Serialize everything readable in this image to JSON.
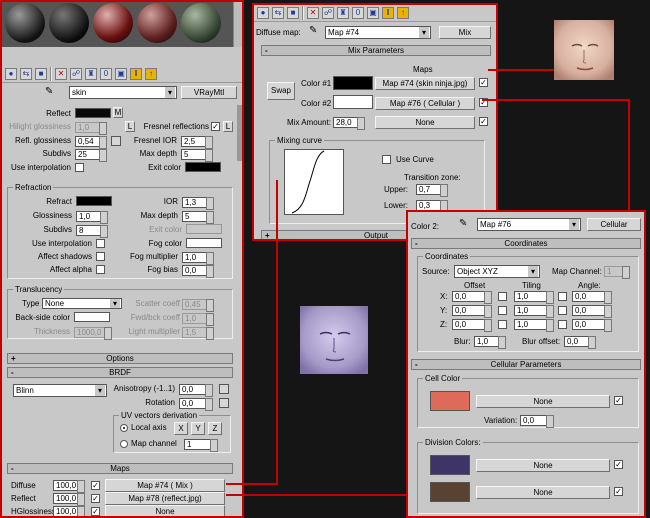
{
  "material_editor": {
    "material_name": "skin",
    "material_type": "VRayMtl",
    "reflection": {
      "reflect_label": "Reflect",
      "reflect_map_btn": "M",
      "hilight_label": "Hilight glossiness",
      "hilight_value": "1,0",
      "hilight_btn": "L",
      "fresnel_label": "Fresnel reflections",
      "fresnel_btn": "L",
      "refl_gloss_label": "Refl. glossiness",
      "refl_gloss_value": "0,54",
      "fresnel_ior_label": "Fresnel IOR",
      "fresnel_ior_value": "2,5",
      "subdivs_label": "Subdivs",
      "subdivs_value": "25",
      "max_depth_label": "Max depth",
      "max_depth_value": "5",
      "use_interp_label": "Use interpolation",
      "exit_color_label": "Exit color"
    },
    "refraction": {
      "title": "Refraction",
      "refract_label": "Refract",
      "ior_label": "IOR",
      "ior_value": "1,3",
      "gloss_label": "Glossiness",
      "gloss_value": "1,0",
      "max_depth_label": "Max depth",
      "max_depth_value": "5",
      "subdivs_label": "Subdivs",
      "subdivs_value": "8",
      "exit_color_label": "Exit color",
      "use_interp_label": "Use interpolation",
      "fog_color_label": "Fog color",
      "affect_shadows_label": "Affect shadows",
      "fog_mult_label": "Fog multiplier",
      "fog_mult_value": "1,0",
      "affect_alpha_label": "Affect alpha",
      "fog_bias_label": "Fog bias",
      "fog_bias_value": "0,0"
    },
    "translucency": {
      "title": "Translucency",
      "type_label": "Type",
      "type_value": "None",
      "scatter_label": "Scatter coeff",
      "scatter_value": "0,45",
      "backside_label": "Back-side color",
      "fwdbck_label": "Fwd/bck coeff",
      "fwdbck_value": "1,0",
      "thickness_label": "Thickness",
      "thickness_value": "1000,0",
      "light_mult_label": "Light multiplier",
      "light_mult_value": "1,5"
    },
    "options_rollout": "Options",
    "brdf": {
      "title": "BRDF",
      "type_value": "Blinn",
      "aniso_label": "Anisotropy (-1..1)",
      "aniso_value": "0,0",
      "rotation_label": "Rotation",
      "rotation_value": "0,0",
      "uv_group": "UV vectors derivation",
      "local_axis_label": "Local axis",
      "axis_x": "X",
      "axis_y": "Y",
      "axis_z": "Z",
      "map_channel_label": "Map channel",
      "map_channel_value": "1"
    },
    "maps": {
      "title": "Maps",
      "rows": [
        {
          "label": "Diffuse",
          "amount": "100,0",
          "map": "Map #74  ( Mix )"
        },
        {
          "label": "Reflect",
          "amount": "100,0",
          "map": "Map #78 (reflect.jpg)"
        },
        {
          "label": "HGlossiness",
          "amount": "100,0",
          "map": "None"
        }
      ]
    }
  },
  "mix_panel": {
    "slot_label": "Diffuse map:",
    "map_name": "Map #74",
    "type_button": "Mix",
    "rollout": "Mix Parameters",
    "maps_header": "Maps",
    "swap_button": "Swap",
    "color1_label": "Color #1",
    "color1_map": "Map #74 (skin ninja.jpg)",
    "color2_label": "Color #2",
    "color2_map": "Map #76  ( Cellular )",
    "mix_amount_label": "Mix Amount:",
    "mix_amount_value": "28,0",
    "mix_map": "None",
    "mixing_curve_label": "Mixing curve",
    "use_curve_label": "Use Curve",
    "transition_label": "Transition zone:",
    "upper_label": "Upper:",
    "upper_value": "0,7",
    "lower_label": "Lower:",
    "lower_value": "0,3",
    "output_rollout": "Output"
  },
  "cellular_panel": {
    "slot_label": "Color 2:",
    "map_name": "Map #76",
    "type_button": "Cellular",
    "coords_rollout": "Coordinates",
    "coords_group": "Coordinates",
    "source_label": "Source:",
    "source_value": "Object XYZ",
    "map_channel_label": "Map Channel:",
    "map_channel_value": "1",
    "offset_header": "Offset",
    "tiling_header": "Tiling",
    "angle_header": "Angle:",
    "axes": [
      {
        "axis": "X:",
        "offset": "0,0",
        "tiling": "1,0",
        "angle": "0,0"
      },
      {
        "axis": "Y:",
        "offset": "0,0",
        "tiling": "1,0",
        "angle": "0,0"
      },
      {
        "axis": "Z:",
        "offset": "0,0",
        "tiling": "1,0",
        "angle": "0,0"
      }
    ],
    "blur_label": "Blur:",
    "blur_value": "1,0",
    "blur_offset_label": "Blur offset:",
    "blur_offset_value": "0,0",
    "cellular_rollout": "Cellular Parameters",
    "cell_color_group": "Cell Color",
    "cell_map": "None",
    "variation_label": "Variation:",
    "variation_value": "0,0",
    "division_group": "Division Colors:",
    "division_maps": [
      "None",
      "None"
    ]
  },
  "colors": {
    "accent_red": "#c40000",
    "cell_color": "#e06a5a",
    "division_color_1": "#3e3466",
    "division_color_2": "#5a4232"
  }
}
